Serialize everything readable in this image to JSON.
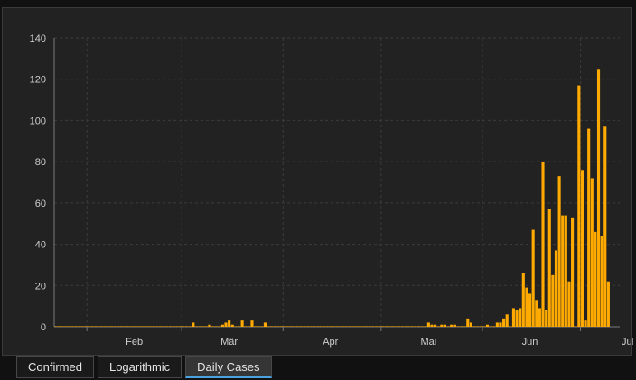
{
  "chart_data": {
    "type": "bar",
    "title": "",
    "xlabel": "",
    "ylabel": "",
    "ylim": [
      0,
      140
    ],
    "yticks": [
      0,
      20,
      40,
      60,
      80,
      100,
      120,
      140
    ],
    "xtick_labels": [
      "Feb",
      "Mär",
      "Apr",
      "Mai",
      "Jun",
      "Jul"
    ],
    "x_range": [
      "2020-01-22",
      "2020-07-13"
    ],
    "grid": true,
    "bar_color": "#ffaa00",
    "x": [
      "2020-01-22",
      "2020-01-23",
      "2020-01-24",
      "2020-01-25",
      "2020-01-26",
      "2020-01-27",
      "2020-01-28",
      "2020-01-29",
      "2020-01-30",
      "2020-01-31",
      "2020-02-01",
      "2020-02-02",
      "2020-02-03",
      "2020-02-04",
      "2020-02-05",
      "2020-02-06",
      "2020-02-07",
      "2020-02-08",
      "2020-02-09",
      "2020-02-10",
      "2020-02-11",
      "2020-02-12",
      "2020-02-13",
      "2020-02-14",
      "2020-02-15",
      "2020-02-16",
      "2020-02-17",
      "2020-02-18",
      "2020-02-19",
      "2020-02-20",
      "2020-02-21",
      "2020-02-22",
      "2020-02-23",
      "2020-02-24",
      "2020-02-25",
      "2020-02-26",
      "2020-02-27",
      "2020-02-28",
      "2020-02-29",
      "2020-03-01",
      "2020-03-02",
      "2020-03-03",
      "2020-03-04",
      "2020-03-05",
      "2020-03-06",
      "2020-03-07",
      "2020-03-08",
      "2020-03-09",
      "2020-03-10",
      "2020-03-11",
      "2020-03-12",
      "2020-03-13",
      "2020-03-14",
      "2020-03-15",
      "2020-03-16",
      "2020-03-17",
      "2020-03-18",
      "2020-03-19",
      "2020-03-20",
      "2020-03-21",
      "2020-03-22",
      "2020-03-23",
      "2020-03-24",
      "2020-03-25",
      "2020-03-26",
      "2020-03-27",
      "2020-03-28",
      "2020-03-29",
      "2020-03-30",
      "2020-03-31",
      "2020-04-01",
      "2020-04-02",
      "2020-04-03",
      "2020-04-04",
      "2020-04-05",
      "2020-04-06",
      "2020-04-07",
      "2020-04-08",
      "2020-04-09",
      "2020-04-10",
      "2020-04-11",
      "2020-04-12",
      "2020-04-13",
      "2020-04-14",
      "2020-04-15",
      "2020-04-16",
      "2020-04-17",
      "2020-04-18",
      "2020-04-19",
      "2020-04-20",
      "2020-04-21",
      "2020-04-22",
      "2020-04-23",
      "2020-04-24",
      "2020-04-25",
      "2020-04-26",
      "2020-04-27",
      "2020-04-28",
      "2020-04-29",
      "2020-04-30",
      "2020-05-01",
      "2020-05-02",
      "2020-05-03",
      "2020-05-04",
      "2020-05-05",
      "2020-05-06",
      "2020-05-07",
      "2020-05-08",
      "2020-05-09",
      "2020-05-10",
      "2020-05-11",
      "2020-05-12",
      "2020-05-13",
      "2020-05-14",
      "2020-05-15",
      "2020-05-16",
      "2020-05-17",
      "2020-05-18",
      "2020-05-19",
      "2020-05-20",
      "2020-05-21",
      "2020-05-22",
      "2020-05-23",
      "2020-05-24",
      "2020-05-25",
      "2020-05-26",
      "2020-05-27",
      "2020-05-28",
      "2020-05-29",
      "2020-05-30",
      "2020-05-31",
      "2020-06-01",
      "2020-06-02",
      "2020-06-03",
      "2020-06-04",
      "2020-06-05",
      "2020-06-06",
      "2020-06-07",
      "2020-06-08",
      "2020-06-09",
      "2020-06-10",
      "2020-06-11",
      "2020-06-12",
      "2020-06-13",
      "2020-06-14",
      "2020-06-15",
      "2020-06-16",
      "2020-06-17",
      "2020-06-18",
      "2020-06-19",
      "2020-06-20",
      "2020-06-21",
      "2020-06-22",
      "2020-06-23",
      "2020-06-24",
      "2020-06-25",
      "2020-06-26",
      "2020-06-27",
      "2020-06-28",
      "2020-06-29",
      "2020-06-30",
      "2020-07-01",
      "2020-07-02",
      "2020-07-03",
      "2020-07-04",
      "2020-07-05",
      "2020-07-06",
      "2020-07-07",
      "2020-07-08",
      "2020-07-09",
      "2020-07-10",
      "2020-07-11",
      "2020-07-12"
    ],
    "values": [
      0,
      0,
      0,
      0,
      0,
      0,
      0,
      0,
      0,
      0,
      0,
      0,
      0,
      0,
      0,
      0,
      0,
      0,
      0,
      0,
      0,
      0,
      0,
      0,
      0,
      0,
      0,
      0,
      0,
      0,
      0,
      0,
      0,
      0,
      0,
      0,
      0,
      0,
      0,
      0,
      0,
      0,
      2,
      0,
      0,
      0,
      0,
      1,
      0,
      0,
      0,
      1,
      2,
      3,
      1,
      0,
      0,
      3,
      0,
      0,
      3,
      0,
      0,
      0,
      2,
      0,
      0,
      0,
      0,
      0,
      0,
      0,
      0,
      0,
      0,
      0,
      0,
      0,
      0,
      0,
      0,
      0,
      0,
      0,
      0,
      0,
      0,
      0,
      0,
      0,
      0,
      0,
      0,
      0,
      0,
      0,
      0,
      0,
      0,
      0,
      0,
      0,
      0,
      0,
      0,
      0,
      0,
      0,
      0,
      0,
      0,
      0,
      0,
      0,
      2,
      1,
      1,
      0,
      1,
      1,
      0,
      1,
      1,
      0,
      0,
      0,
      4,
      2,
      0,
      0,
      0,
      0,
      1,
      0,
      0,
      2,
      2,
      4,
      6,
      0,
      9,
      8,
      9,
      26,
      19,
      16,
      47,
      13,
      9,
      80,
      8,
      57,
      25,
      37,
      73,
      54,
      54,
      22,
      53,
      0,
      117,
      76,
      3,
      96,
      72,
      46,
      125,
      44,
      97,
      22
    ]
  },
  "tabs": [
    {
      "label": "Confirmed",
      "active": false
    },
    {
      "label": "Logarithmic",
      "active": false
    },
    {
      "label": "Daily Cases",
      "active": true
    }
  ]
}
